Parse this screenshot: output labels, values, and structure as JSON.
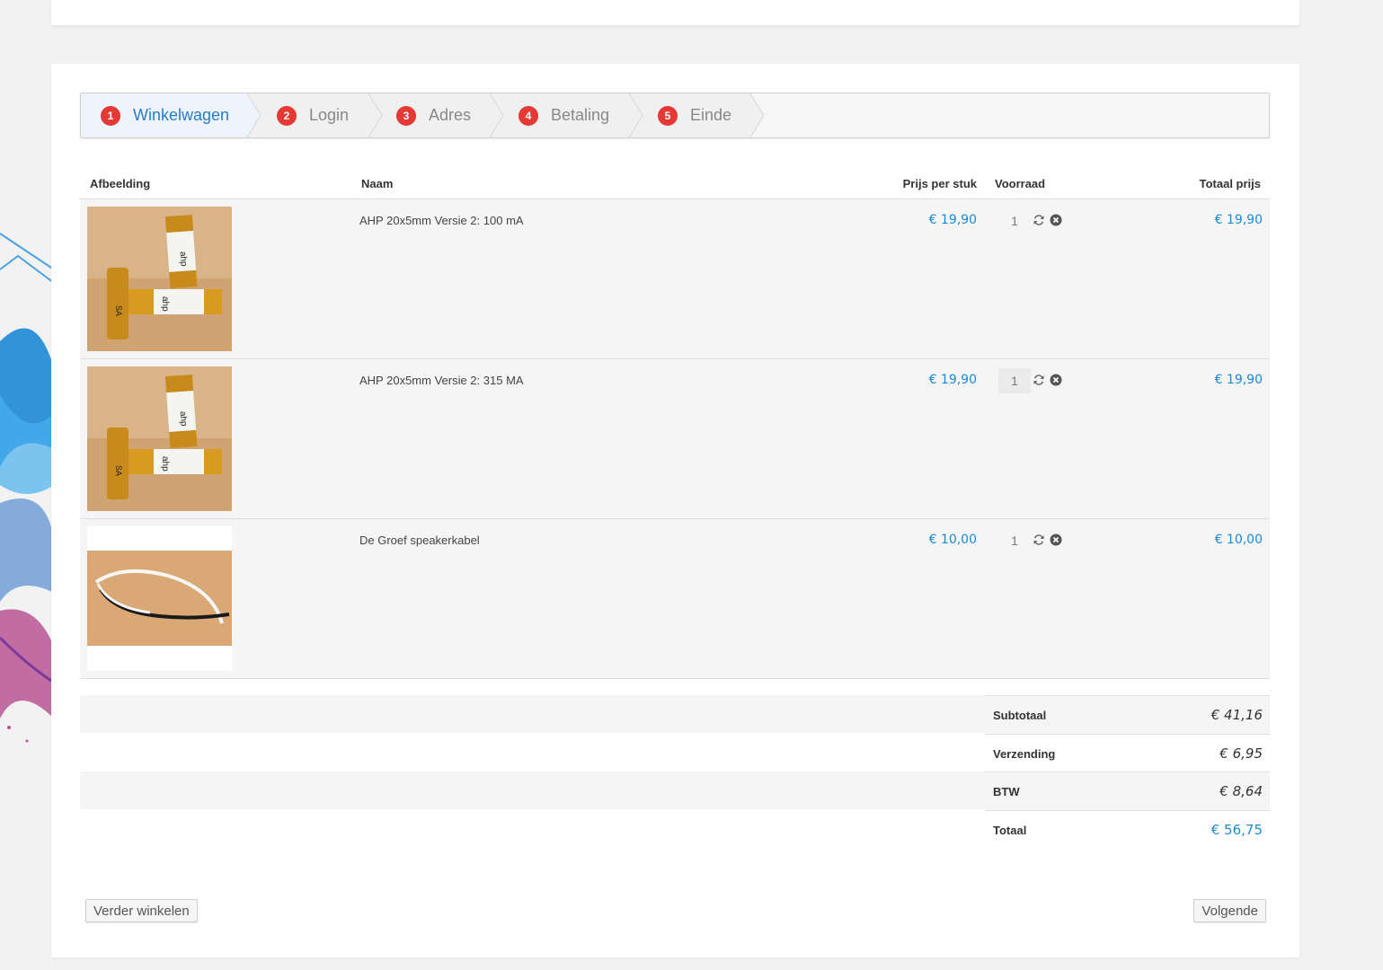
{
  "steps": [
    {
      "num": "1",
      "label": "Winkelwagen"
    },
    {
      "num": "2",
      "label": "Login"
    },
    {
      "num": "3",
      "label": "Adres"
    },
    {
      "num": "4",
      "label": "Betaling"
    },
    {
      "num": "5",
      "label": "Einde"
    }
  ],
  "table": {
    "headers": {
      "image": "Afbeelding",
      "name": "Naam",
      "unit_price": "Prijs per stuk",
      "stock": "Voorraad",
      "total": "Totaal prijs"
    },
    "rows": [
      {
        "name": "AHP 20x5mm Versie 2: 100 mA",
        "unit_price": "€ 19,90",
        "qty": "1",
        "total": "€ 19,90"
      },
      {
        "name": "AHP 20x5mm Versie 2: 315 MA",
        "unit_price": "€ 19,90",
        "qty": "1",
        "total": "€ 19,90"
      },
      {
        "name": "De Groef speakerkabel",
        "unit_price": "€ 10,00",
        "qty": "1",
        "total": "€ 10,00"
      }
    ]
  },
  "totals": {
    "subtotal_label": "Subtotaal",
    "subtotal": "€ 41,16",
    "shipping_label": "Verzending",
    "shipping": "€ 6,95",
    "vat_label": "BTW",
    "vat": "€ 8,64",
    "total_label": "Totaal",
    "total": "€ 56,75"
  },
  "buttons": {
    "continue_shopping": "Verder winkelen",
    "next": "Volgende"
  },
  "icons": {
    "refresh": "refresh-icon",
    "remove": "remove-icon"
  },
  "colors": {
    "accent": "#1a8bd2",
    "step_badge": "#e53935",
    "active_step": "#2b7cc4"
  }
}
